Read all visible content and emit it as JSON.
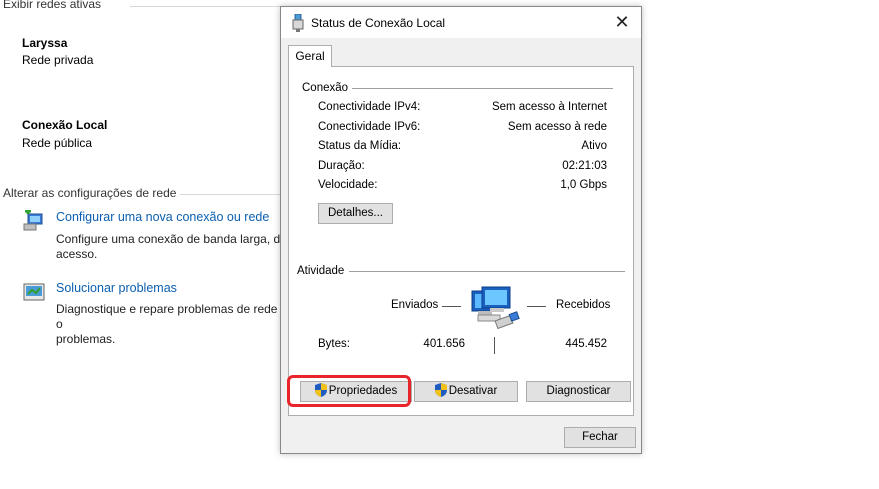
{
  "background": {
    "active_networks_title": "Exibir redes ativas",
    "networks": [
      {
        "name": "Laryssa",
        "type": "Rede privada"
      },
      {
        "name": "Conexão Local",
        "type": "Rede pública"
      }
    ],
    "change_settings_title": "Alterar as configurações de rede",
    "tasks": [
      {
        "link": "Configurar uma nova conexão ou rede",
        "desc_line1": "Configure uma conexão de banda larga, di",
        "desc_line2": "acesso."
      },
      {
        "link": "Solucionar problemas",
        "desc_line1": "Diagnostique e repare problemas de rede o",
        "desc_line2": "problemas."
      }
    ]
  },
  "dialog": {
    "title": "Status de Conexão Local",
    "tab": "Geral",
    "connection": {
      "group_label": "Conexão",
      "rows": [
        {
          "label": "Conectividade IPv4:",
          "value": "Sem acesso à Internet"
        },
        {
          "label": "Conectividade IPv6:",
          "value": "Sem acesso à rede"
        },
        {
          "label": "Status da Mídia:",
          "value": "Ativo"
        },
        {
          "label": "Duração:",
          "value": "02:21:03"
        },
        {
          "label": "Velocidade:",
          "value": "1,0 Gbps"
        }
      ],
      "details_button": "Detalhes..."
    },
    "activity": {
      "group_label": "Atividade",
      "sent_label": "Enviados",
      "received_label": "Recebidos",
      "bytes_label": "Bytes:",
      "bytes_sent": "401.656",
      "bytes_received": "445.452"
    },
    "buttons": {
      "properties": "Propriedades",
      "disable": "Desativar",
      "diagnose": "Diagnosticar",
      "close": "Fechar"
    }
  },
  "colors": {
    "link": "#0b5fb0",
    "highlight": "#e8252b",
    "dialog_bg": "#f0f0f0"
  }
}
